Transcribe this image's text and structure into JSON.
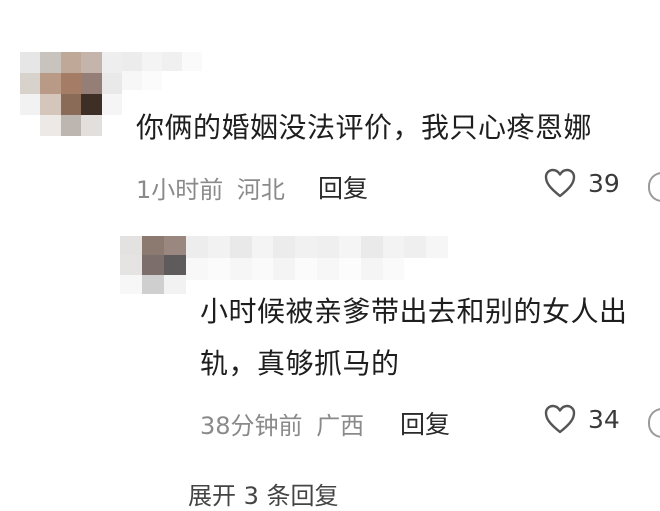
{
  "comments": [
    {
      "text": "你俩的婚姻没法评价，我只心疼恩娜",
      "time": "1小时前",
      "location": "河北",
      "reply_label": "回复",
      "likes": "39"
    }
  ],
  "reply": {
    "text_line1": "小时候被亲爹带出去和别的女人出",
    "text_line2": "轨，真够抓马的",
    "time": "38分钟前",
    "location": "广西",
    "reply_label": "回复",
    "likes": "34"
  },
  "expand_text": "展开 3 条回复",
  "colors": {
    "text_primary": "#1e1e1e",
    "text_meta": "#8a8a8a",
    "icon": "#555555"
  },
  "icons": [
    "heart-icon",
    "comment-icon"
  ]
}
